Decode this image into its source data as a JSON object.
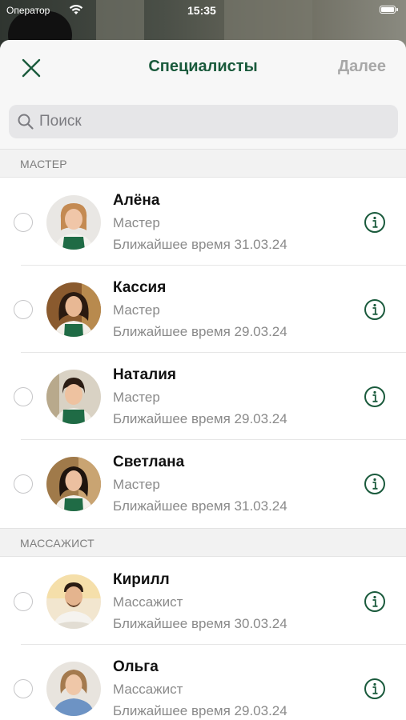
{
  "status_bar": {
    "carrier": "Оператор",
    "time": "15:35"
  },
  "header": {
    "title": "Специалисты",
    "next_label": "Далее"
  },
  "search": {
    "placeholder": "Поиск",
    "value": ""
  },
  "sections": [
    {
      "title": "МАСТЕР"
    },
    {
      "title": "МАССАЖИСТ"
    }
  ],
  "specialists": [
    {
      "name": "Алёна",
      "role": "Мастер",
      "nearest": "Ближайшее время 31.03.24",
      "selected": false
    },
    {
      "name": "Кассия",
      "role": "Мастер",
      "nearest": "Ближайшее время 29.03.24",
      "selected": false
    },
    {
      "name": "Наталия",
      "role": "Мастер",
      "nearest": "Ближайшее время 29.03.24",
      "selected": false
    },
    {
      "name": "Светлана",
      "role": "Мастер",
      "nearest": "Ближайшее время 31.03.24",
      "selected": false
    },
    {
      "name": "Кирилл",
      "role": "Массажист",
      "nearest": "Ближайшее время 30.03.24",
      "selected": false
    },
    {
      "name": "Ольга",
      "role": "Массажист",
      "nearest": "Ближайшее время 29.03.24",
      "selected": false
    }
  ],
  "colors": {
    "accent": "#1a5a3c",
    "disabled": "#a8a8a8",
    "apron": "#1f6b45"
  }
}
